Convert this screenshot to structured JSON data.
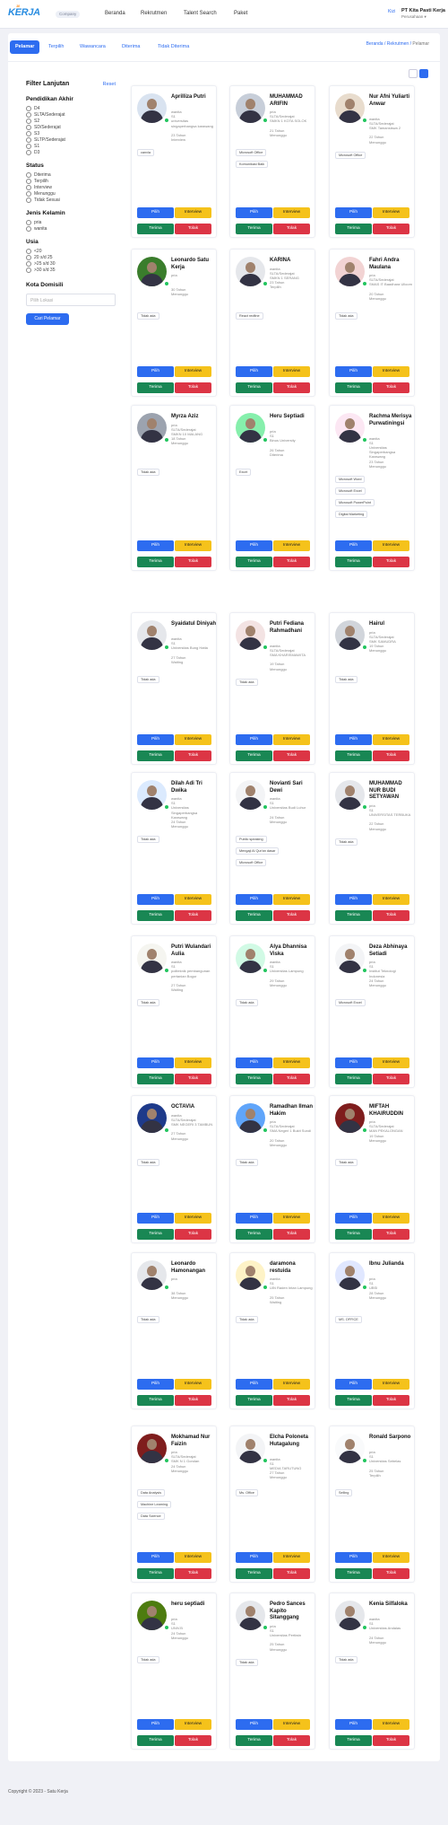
{
  "header": {
    "logo": "KERJA",
    "logo_badge": "10",
    "company_badge": "Company",
    "nav": [
      "Beranda",
      "Rekrutmen",
      "Talent Search",
      "Paket"
    ],
    "greeting": "Kizi",
    "company_name": "PT Kita Pasti Kerja",
    "role": "Perusahaan"
  },
  "tabs": [
    "Pelamar",
    "Terpilih",
    "Wawancara",
    "Diterima",
    "Tidak Diterima"
  ],
  "breadcrumb": {
    "a": "Beranda",
    "b": "Rekrutmen",
    "c": "Pelamar",
    "sep": "/"
  },
  "filter": {
    "title": "Filter Lanjutan",
    "reset": "Reset",
    "pendidikan_title": "Pendidikan Akhir",
    "pendidikan": [
      "D4",
      "SLTA/Sederajat",
      "S2",
      "SD/Sederajat",
      "S3",
      "SLTP/Sederajat",
      "S1",
      "D3"
    ],
    "status_title": "Status",
    "status": [
      "Diterima",
      "Terpilih",
      "Interview",
      "Menunggu",
      "Tidak Sesuai"
    ],
    "jk_title": "Jenis Kelamin",
    "jk": [
      "pria",
      "wanita"
    ],
    "usia_title": "Usia",
    "usia": [
      "<20",
      "20 s/d 25",
      ">25 s/d 30",
      ">30 s/d 35"
    ],
    "kota_title": "Kota Domisili",
    "kota_placeholder": "Pilih Lokasi",
    "cari": "Cari Pelamar"
  },
  "buttons": {
    "pilih": "Pilih",
    "interview": "Interview",
    "terima": "Terima",
    "tolak": "Tolak"
  },
  "candidates": [
    {
      "name": "Aprilliza Putri",
      "info": [
        "wanita",
        "S1",
        "universitas singaperbangsa karawang",
        "23 Tahun",
        "Interview"
      ],
      "skills": [
        "canvla"
      ]
    },
    {
      "name": "MUHAMMAD ARIFIN",
      "info": [
        "pria",
        "SLTA/Sederajat",
        "SMKN 1 KOTA SOLOK",
        "21 Tahun",
        "Menunggu"
      ],
      "skills": [
        "Microsoft Office",
        "Komunikasi Baik"
      ]
    },
    {
      "name": "Nur Afni Yuliarti Anwar",
      "info": [
        "wanita",
        "SLTA/Sederajat",
        "SMK Tamansiswa 2",
        "22 Tahun",
        "Menunggu"
      ],
      "skills": [
        "Microsoft Office"
      ]
    },
    {
      "name": "Leonardo Satu Kerja",
      "info": [
        "pria",
        "",
        "",
        "30 Tahun",
        "Menunggu"
      ],
      "skills": [
        "Tidak ada"
      ]
    },
    {
      "name": "KARINA",
      "info": [
        "wanita",
        "SLTA/Sederajat",
        "SMKN 1 SERANG",
        "23 Tahun",
        "Terpilih"
      ],
      "skills": [
        "React redfine"
      ]
    },
    {
      "name": "Fahri Andra Maulana",
      "info": [
        "pria",
        "SLTA/Sederajat",
        "SMAS IT Baadhara Ulloom",
        "20 Tahun",
        "Menunggu"
      ],
      "skills": [
        "Tidak ada"
      ]
    },
    {
      "name": "Myrza Aziz",
      "info": [
        "pria",
        "SLTA/Sederajat",
        "SMKN 10 MALANG",
        "18 Tahun",
        "Menunggu"
      ],
      "skills": [
        "Tidak ada"
      ]
    },
    {
      "name": "Heru Septiadi",
      "info": [
        "pria",
        "S1",
        "Binus University",
        "26 Tahun",
        "Diterima"
      ],
      "skills": [
        "Excel"
      ]
    },
    {
      "name": "Rachma Merisya Purwatiningsi",
      "info": [
        "wanita",
        "S1",
        "Universitas Singaperbangsa Karawang",
        "23 Tahun",
        "Menunggu"
      ],
      "skills": [
        "Microsoft Word",
        "Microsoft Excel",
        "Microsoft PowerPoint",
        "Digital Marketing"
      ]
    },
    {
      "name": "Syaidatul Diniyah",
      "info": [
        "wanita",
        "S1",
        "Universitas Bung Hatta",
        "27 Tahun",
        "Waiting"
      ],
      "skills": [
        "Tidak ada"
      ]
    },
    {
      "name": "Putri Fediana Rahmadhani",
      "info": [
        "wanita",
        "SLTA/Sederajat",
        "SMA KHARISMAWITA",
        "19 Tahun",
        "Menunggu"
      ],
      "skills": [
        "Tidak ada"
      ]
    },
    {
      "name": "Hairul",
      "info": [
        "pria",
        "SLTA/Sederajat",
        "SMK SAMUDRA",
        "19 Tahun",
        "Menunggu"
      ],
      "skills": [
        "Tidak ada"
      ]
    },
    {
      "name": "Dilah Adi Tri Dwika",
      "info": [
        "wanita",
        "S1",
        "Universitas Singaperbangsa Karawang",
        "24 Tahun",
        "Menunggu"
      ],
      "skills": [
        "Tidak ada"
      ]
    },
    {
      "name": "Novianti Sari Dewi",
      "info": [
        "wanita",
        "S1",
        "Universitas Budi Luhur",
        "24 Tahun",
        "Menunggu"
      ],
      "skills": [
        "Public speaking",
        "Mengaji Al Qur'an dasar",
        "Microsoft Office"
      ]
    },
    {
      "name": "MUHAMMAD NUR BUDI SETYAWAN",
      "info": [
        "pria",
        "S1",
        "UNIVERSITAS TERBUKA",
        "22 Tahun",
        "Menunggu"
      ],
      "skills": [
        "Tidak ada"
      ]
    },
    {
      "name": "Putri Wulandari Aulia",
      "info": [
        "wanita",
        "S1",
        "politeknik pembangunan pertanian Bogor",
        "27 Tahun",
        "Waiting"
      ],
      "skills": [
        "Tidak ada"
      ]
    },
    {
      "name": "Alya Dhannisa Viska",
      "info": [
        "wanita",
        "S1",
        "Universitas Lampung",
        "29 Tahun",
        "Menunggu"
      ],
      "skills": [
        "Tidak ada"
      ]
    },
    {
      "name": "Deza Abhinaya Setiadi",
      "info": [
        "pria",
        "S1",
        "Institut Teknologi Indonesia",
        "24 Tahun",
        "Menunggu"
      ],
      "skills": [
        "Microsoft Excel"
      ]
    },
    {
      "name": "OCTAVIA",
      "info": [
        "wanita",
        "SLTA/Sederajat",
        "SMK NEGERI 3 TAMBUN",
        "27 Tahun",
        "Menunggu"
      ],
      "skills": [
        "Tidak ada"
      ]
    },
    {
      "name": "Ramadhan Ilman Hakim",
      "info": [
        "pria",
        "SLTA/Sederajat",
        "SMA Negeri 1 Bukit Sundi",
        "20 Tahun",
        "Menunggu"
      ],
      "skills": [
        "Tidak ada"
      ]
    },
    {
      "name": "MIFTAH KHAIRUDDIN",
      "info": [
        "pria",
        "SLTA/Sederajat",
        "MAN PEKALONGAN",
        "19 Tahun",
        "Menunggu"
      ],
      "skills": [
        "Tidak ada"
      ]
    },
    {
      "name": "Leonardo Hamonangan",
      "info": [
        "pria",
        "",
        "",
        "38 Tahun",
        "Menunggu"
      ],
      "skills": [
        "Tidak ada"
      ]
    },
    {
      "name": "daramona restuida",
      "info": [
        "wanita",
        "S1",
        "UIN Raden Intan Lampung",
        "25 Tahun",
        "Waiting"
      ],
      "skills": [
        "Tidak ada"
      ]
    },
    {
      "name": "Ibnu Julianda",
      "info": [
        "pria",
        "S1",
        "UBSI",
        "28 Tahun",
        "Menunggu"
      ],
      "skills": [
        "MS. OFFICE"
      ]
    },
    {
      "name": "Mokhamad Nur Faizin",
      "info": [
        "pria",
        "SLTA/Sederajat",
        "SMK N 1 Gondan",
        "24 Tahun",
        "Menunggu"
      ],
      "skills": [
        "Data Analysis",
        "Machine Learning",
        "Data Science"
      ]
    },
    {
      "name": "Elcha Poloneta Hutagalung",
      "info": [
        "wanita",
        "S1",
        "MEDIA TARUTUNG",
        "27 Tahun",
        "Menunggu"
      ],
      "skills": [
        "Ms. Office"
      ]
    },
    {
      "name": "Ronald Sarpono",
      "info": [
        "pria",
        "S1",
        "Universitas Sebelas",
        "25 Tahun",
        "Terpilih"
      ],
      "skills": [
        "Selling"
      ]
    },
    {
      "name": "heru septiadi",
      "info": [
        "pria",
        "S1",
        "UNIV.B",
        "24 Tahun",
        "Menunggu"
      ],
      "skills": [
        "Tidak ada"
      ]
    },
    {
      "name": "Pedro Sances Kapito Sitanggang",
      "info": [
        "pria",
        "S1",
        "Universitas Pertiwin",
        "25 Tahun",
        "Menunggu"
      ],
      "skills": [
        "Tidak ada"
      ]
    },
    {
      "name": "Kenia Silfaloka",
      "info": [
        "wanita",
        "S1",
        "Universitas Andalas",
        "24 Tahun",
        "Menunggu"
      ],
      "skills": [
        "Tidak ada"
      ]
    }
  ],
  "footer": "Copyright © 2023 - Satu Kerja"
}
